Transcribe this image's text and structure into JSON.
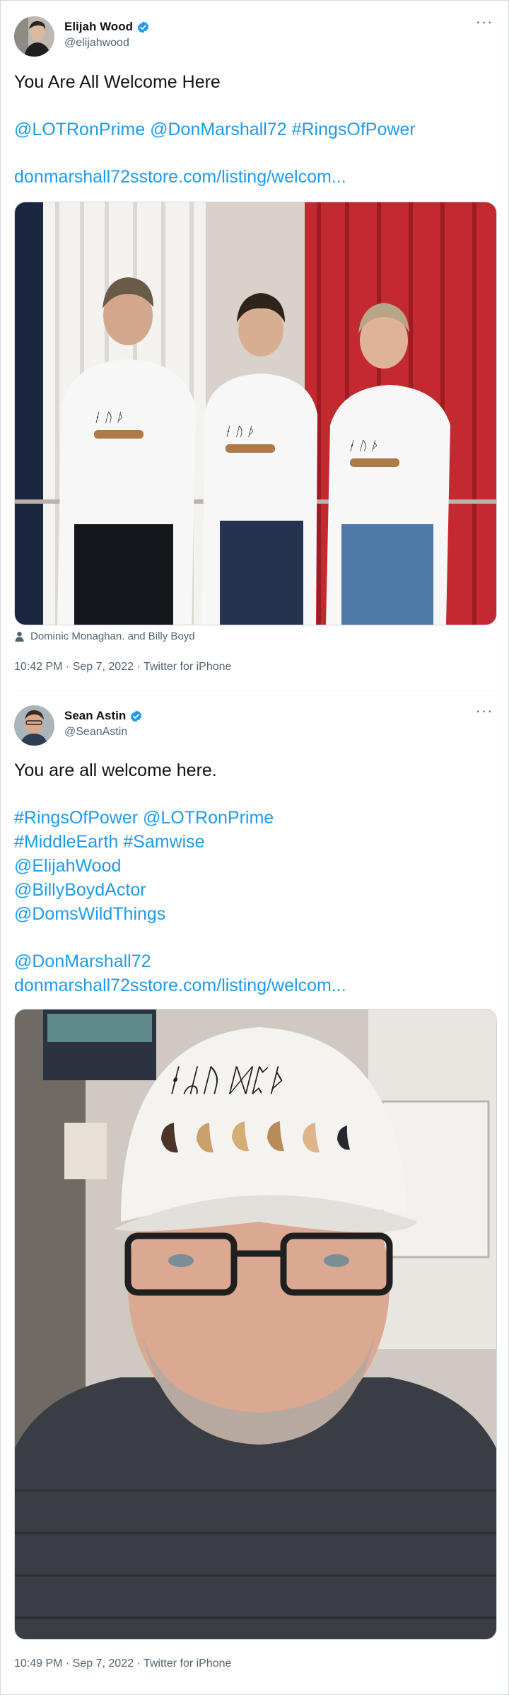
{
  "tweet1": {
    "display_name": "Elijah Wood",
    "handle": "@elijahwood",
    "text": "You Are All Welcome Here",
    "mentions": [
      "@LOTRonPrime",
      "@DonMarshall72",
      "#RingsOfPower"
    ],
    "link": "donmarshall72sstore.com/listing/welcom...",
    "tagged_people": "Dominic Monaghan. and Billy Boyd",
    "time": "10:42 PM",
    "date": "Sep 7, 2022",
    "source": "Twitter for iPhone"
  },
  "tweet2": {
    "display_name": "Sean Astin",
    "handle": "@SeanAstin",
    "text": "You are all welcome here.",
    "lines": [
      [
        "#RingsOfPower",
        "@LOTRonPrime"
      ],
      [
        "#MiddleEarth",
        "#Samwise"
      ],
      [
        "@ElijahWood"
      ],
      [
        "@BillyBoydActor"
      ],
      [
        "@DomsWildThings"
      ]
    ],
    "mention": "@DonMarshall72",
    "link": "donmarshall72sstore.com/listing/welcom...",
    "time": "10:49 PM",
    "date": "Sep 7, 2022",
    "source": "Twitter for iPhone"
  },
  "colors": {
    "link": "#1d9bf0",
    "secondary": "#536471",
    "verified": "#1d9bf0",
    "border": "#cfd9de"
  },
  "icons": [
    "verified-badge-icon",
    "more-options-icon",
    "person-tag-icon"
  ]
}
